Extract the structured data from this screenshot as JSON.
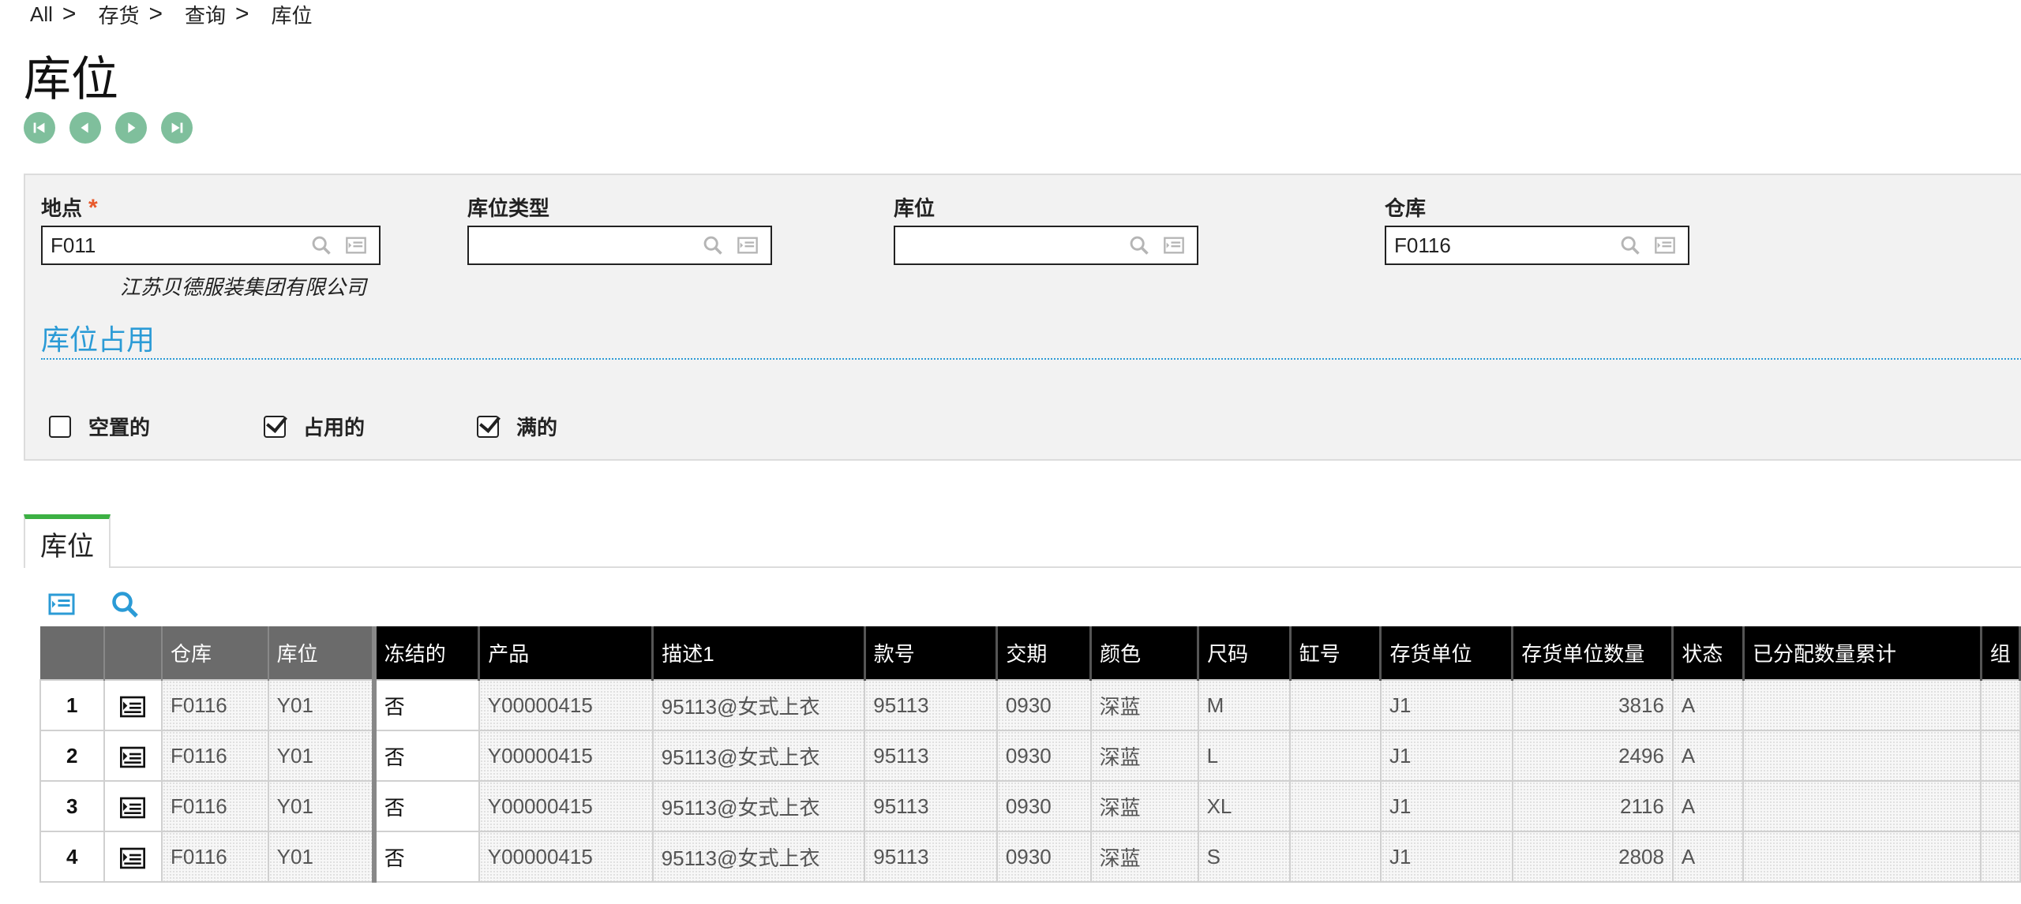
{
  "breadcrumb": [
    {
      "label": "All"
    },
    {
      "label": "存货"
    },
    {
      "label": "查询"
    },
    {
      "label": "库位"
    }
  ],
  "breadcrumb_separator": ">",
  "page_title": "库位",
  "nav_buttons": [
    "first-record-icon",
    "previous-record-icon",
    "next-record-icon",
    "last-record-icon"
  ],
  "filters": {
    "site": {
      "label": "地点",
      "required_mark": "*",
      "value": "F011",
      "description": "江苏贝德服装集团有限公司"
    },
    "location_type": {
      "label": "库位类型",
      "value": ""
    },
    "location": {
      "label": "库位",
      "value": ""
    },
    "warehouse": {
      "label": "仓库",
      "value": "F0116"
    }
  },
  "occupancy": {
    "title": "库位占用",
    "options": [
      {
        "label": "空置的",
        "checked": false
      },
      {
        "label": "占用的",
        "checked": true
      },
      {
        "label": "满的",
        "checked": true
      }
    ]
  },
  "tab_label": "库位",
  "colors": {
    "accent_blue": "#2b9bd6",
    "nav_green": "#7fbf9c",
    "tab_green": "#3cb043",
    "required_orange": "#e8592b"
  },
  "table": {
    "columns": [
      "仓库",
      "库位",
      "冻结的",
      "产品",
      "描述1",
      "款号",
      "交期",
      "颜色",
      "尺码",
      "缸号",
      "存货单位",
      "存货单位数量",
      "状态",
      "已分配数量累计",
      "组"
    ],
    "rows": [
      {
        "no": "1",
        "warehouse": "F0116",
        "location": "Y01",
        "frozen": "否",
        "product": "Y00000415",
        "desc": "95113@女式上衣",
        "style": "95113",
        "delivery": "0930",
        "color": "深蓝",
        "size": "M",
        "batch": "",
        "unit": "J1",
        "qty": "3816",
        "status": "A",
        "allocated": ""
      },
      {
        "no": "2",
        "warehouse": "F0116",
        "location": "Y01",
        "frozen": "否",
        "product": "Y00000415",
        "desc": "95113@女式上衣",
        "style": "95113",
        "delivery": "0930",
        "color": "深蓝",
        "size": "L",
        "batch": "",
        "unit": "J1",
        "qty": "2496",
        "status": "A",
        "allocated": ""
      },
      {
        "no": "3",
        "warehouse": "F0116",
        "location": "Y01",
        "frozen": "否",
        "product": "Y00000415",
        "desc": "95113@女式上衣",
        "style": "95113",
        "delivery": "0930",
        "color": "深蓝",
        "size": "XL",
        "batch": "",
        "unit": "J1",
        "qty": "2116",
        "status": "A",
        "allocated": ""
      },
      {
        "no": "4",
        "warehouse": "F0116",
        "location": "Y01",
        "frozen": "否",
        "product": "Y00000415",
        "desc": "95113@女式上衣",
        "style": "95113",
        "delivery": "0930",
        "color": "深蓝",
        "size": "S",
        "batch": "",
        "unit": "J1",
        "qty": "2808",
        "status": "A",
        "allocated": ""
      }
    ]
  }
}
